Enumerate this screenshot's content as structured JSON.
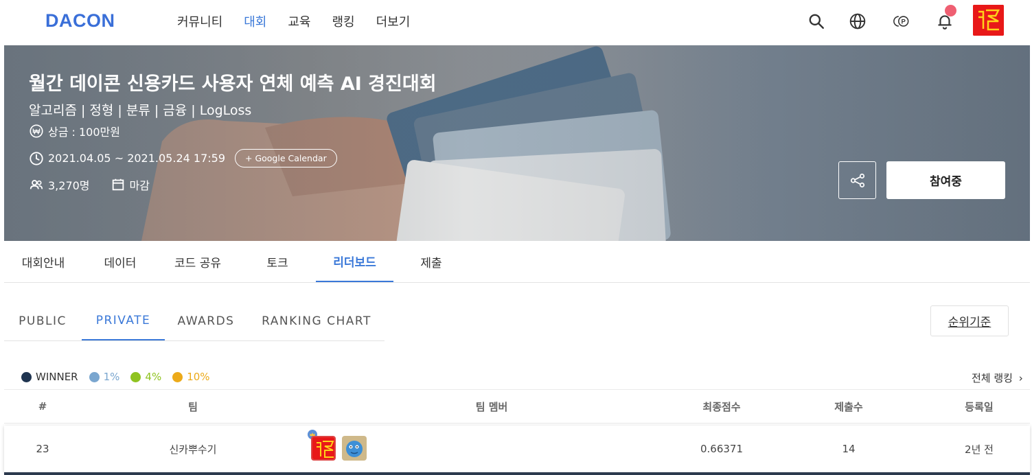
{
  "nav": {
    "logo": "DACON",
    "menu": [
      "커뮤니티",
      "대회",
      "교육",
      "랭킹",
      "더보기"
    ],
    "active_menu": "대회",
    "icons": [
      "search-icon",
      "globe-icon",
      "point-icon",
      "bell-icon"
    ]
  },
  "banner": {
    "title": "월간 데이콘 신용카드 사용자 연체 예측 AI 경진대회",
    "tags": "알고리즘 | 정형 | 분류 | 금융 | LogLoss",
    "prize": "상금 : 100만원",
    "period": "2021.04.05 ~ 2021.05.24 17:59",
    "calendar_button": "+ Google Calendar",
    "participants": "3,270명",
    "status": "마감",
    "join_button": "참여중"
  },
  "main_tabs": [
    "대회안내",
    "데이터",
    "코드 공유",
    "토크",
    "리더보드",
    "제출"
  ],
  "active_main_tab": "리더보드",
  "sub_tabs": [
    "PUBLIC",
    "PRIVATE",
    "AWARDS",
    "RANKING CHART"
  ],
  "active_sub_tab": "PRIVATE",
  "rank_basis_button": "순위기준",
  "legend": [
    {
      "label": "WINNER",
      "color": "#1f3450"
    },
    {
      "label": "1%",
      "color": "#7aa6cf"
    },
    {
      "label": "4%",
      "color": "#8fc320"
    },
    {
      "label": "10%",
      "color": "#ecaa1a"
    }
  ],
  "full_ranking_link": "전체 랭킹",
  "table": {
    "headers": [
      "#",
      "팀",
      "팀 멤버",
      "최종점수",
      "제출수",
      "등록일"
    ],
    "rows": [
      {
        "rank": "23",
        "team": "신카뿌수기",
        "score": "0.66371",
        "submissions": "14",
        "registered": "2년 전"
      }
    ]
  },
  "colors": {
    "accent": "#3a78d8",
    "brand": "#3a6fd8",
    "notification": "#ef5f72"
  }
}
